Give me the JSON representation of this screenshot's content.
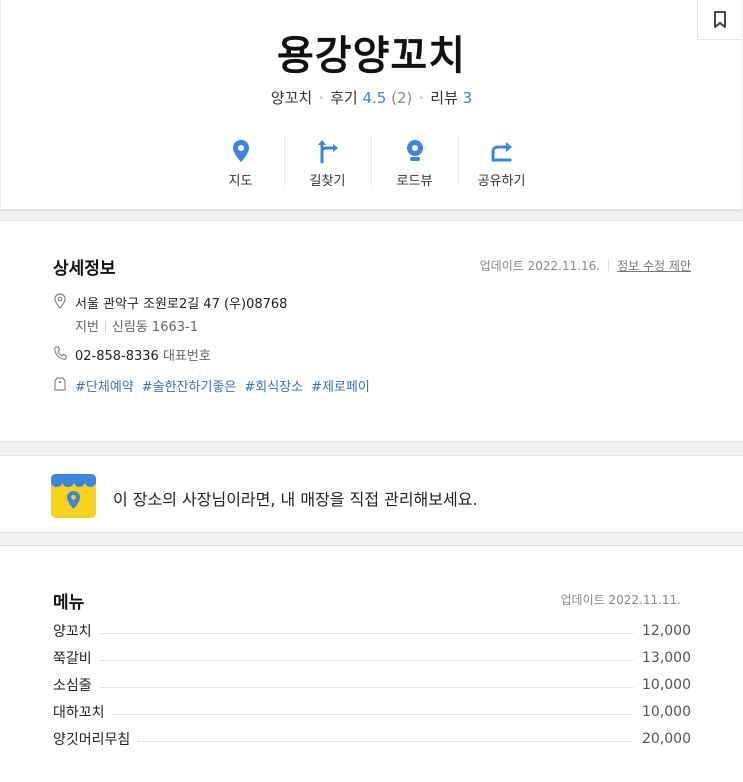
{
  "place": {
    "name": "용강양꼬치",
    "category": "양꼬치",
    "review_label": "후기",
    "rating": "4.5",
    "rating_count": "(2)",
    "blog_review_label": "리뷰",
    "blog_review_count": "3"
  },
  "actions": [
    {
      "label": "지도",
      "icon": "map-pin-icon"
    },
    {
      "label": "길찾기",
      "icon": "directions-icon"
    },
    {
      "label": "로드뷰",
      "icon": "roadview-icon"
    },
    {
      "label": "공유하기",
      "icon": "share-icon"
    }
  ],
  "details": {
    "title": "상세정보",
    "updated": "업데이트 2022.11.16.",
    "suggest_edit": "정보 수정 제안",
    "address": "서울 관악구 조원로2길 47 (우)08768",
    "lot_label": "지번",
    "lot_address": "신림동 1663-1",
    "phone": "02-858-8336",
    "phone_label": "대표번호",
    "tags": [
      "#단체예약",
      "#술한잔하기좋은",
      "#회식장소",
      "#제로페이"
    ]
  },
  "owner": {
    "message": "이 장소의 사장님이라면, 내 매장을 직접 관리해보세요."
  },
  "menu": {
    "title": "메뉴",
    "updated": "업데이트 2022.11.11.",
    "items": [
      {
        "name": "양꼬치",
        "price": "12,000"
      },
      {
        "name": "쭉갈비",
        "price": "13,000"
      },
      {
        "name": "소심줄",
        "price": "10,000"
      },
      {
        "name": "대하꼬치",
        "price": "10,000"
      },
      {
        "name": "양깃머리무침",
        "price": "20,000"
      }
    ]
  },
  "colors": {
    "accent": "#3b84e0",
    "tag": "#3b6fb6",
    "owner_yellow": "#f7d21a"
  }
}
